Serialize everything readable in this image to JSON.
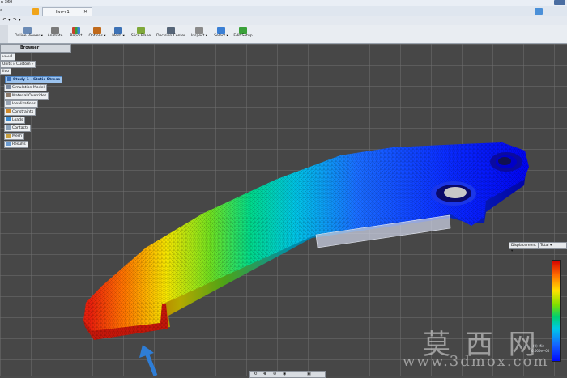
{
  "app": {
    "title_fragment": "n 360"
  },
  "tabs": {
    "doc_tab_label": "livo-v1"
  },
  "quick_access": {
    "undo_glyph": "↶ ▾",
    "redo_glyph": "↷ ▾"
  },
  "ribbon": {
    "buttons": [
      {
        "label": "Online Viewer ▾",
        "icon": "online-viewer-icon",
        "color": "#6b8bb6"
      },
      {
        "label": "Animate",
        "icon": "animate-icon",
        "color": "#7a7a7a"
      },
      {
        "label": "Report",
        "icon": "report-icon",
        "color": "#c7422c"
      },
      {
        "label": "Options ▾",
        "icon": "options-icon",
        "color": "#c06a1c"
      },
      {
        "label": "Mesh ▾",
        "icon": "mesh-icon",
        "color": "#3d72b6"
      },
      {
        "label": "Slice Plane",
        "icon": "slice-plane-icon",
        "color": "#7fa83a"
      },
      {
        "label": "Decision Center",
        "icon": "decision-center-icon",
        "color": "#566578"
      },
      {
        "label": "Inspect ▾",
        "icon": "inspect-icon",
        "color": "#8a8a8a"
      },
      {
        "label": "Select ▾",
        "icon": "select-icon",
        "color": "#3b7fd4"
      },
      {
        "label": "Edit Setup",
        "icon": "checkmark-icon",
        "color": "#3aa13a"
      }
    ]
  },
  "browser": {
    "header": "Browser",
    "root_fragment": "vo-v1",
    "units": "Units ▹ Custom ▹",
    "node_fragment": "livo",
    "study_label": "Study 1 - Static Stress",
    "items": [
      {
        "label": "Simulation Model",
        "icon": "simulation-model-icon"
      },
      {
        "label": "Material Overrides",
        "icon": "material-icon"
      },
      {
        "label": "Idealizations",
        "icon": "idealizations-icon"
      },
      {
        "label": "Constraints",
        "icon": "constraints-icon"
      },
      {
        "label": "Loads",
        "icon": "loads-icon"
      },
      {
        "label": "Contacts",
        "icon": "contacts-icon"
      },
      {
        "label": "Mesh",
        "icon": "mesh-icon"
      },
      {
        "label": "Results",
        "icon": "results-icon"
      }
    ]
  },
  "results": {
    "type_select": "Displacement ▾",
    "component_select": "Total ▾",
    "legend_bottom_label_1": "(0) Min",
    "legend_bottom_label_2": "0.000e+00"
  },
  "watermark": {
    "cn": "莫 西 网",
    "url": "www.3dmox.com"
  },
  "colors": {
    "ribbon_bg": "#e9edf2",
    "viewport_bg": "#474747",
    "selection": "#9cc3ee"
  }
}
